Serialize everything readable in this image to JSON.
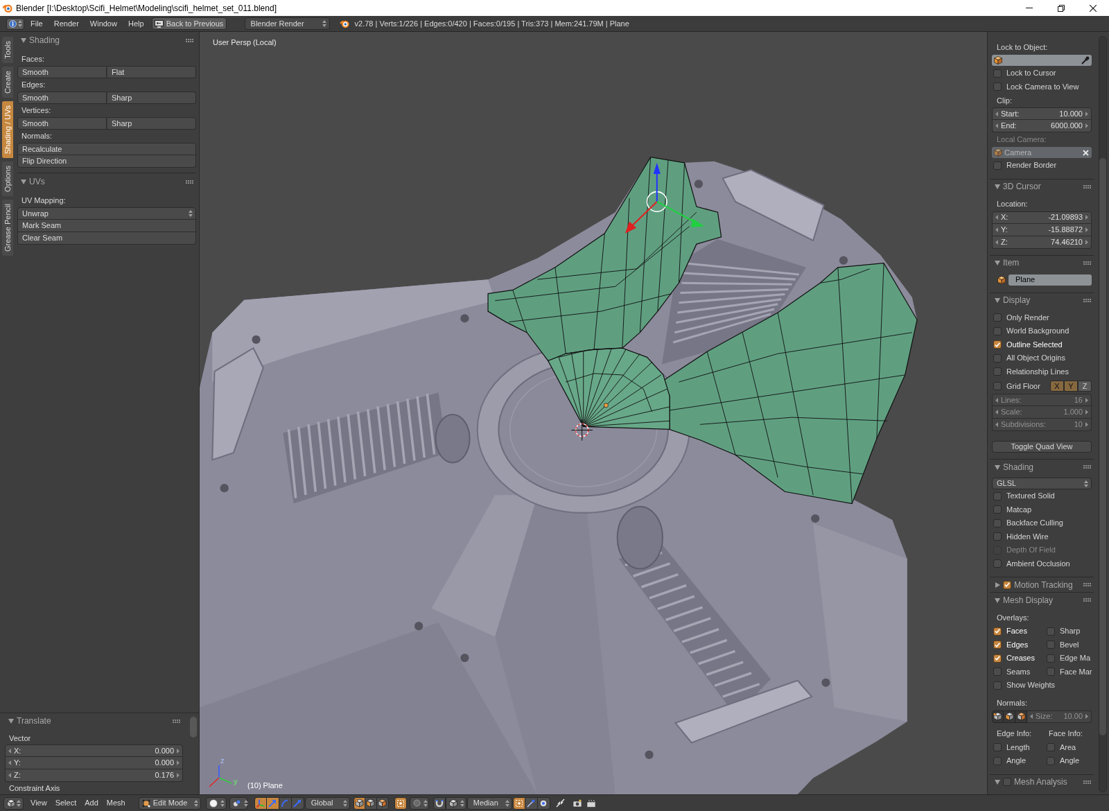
{
  "window": {
    "title": "Blender [I:\\Desktop\\Scifi_Helmet\\Modeling\\scifi_helmet_set_011.blend]"
  },
  "menu_bar": {
    "menus": [
      "File",
      "Render",
      "Window",
      "Help"
    ],
    "back_button": "Back to Previous",
    "render_engine": "Blender Render",
    "stats": "v2.78 | Verts:1/226 | Edges:0/420 | Faces:0/195 | Tris:373 | Mem:241.79M | Plane"
  },
  "tool_shelf": {
    "tabs": [
      {
        "label": "Tools",
        "selected": false
      },
      {
        "label": "Create",
        "selected": false
      },
      {
        "label": "Shading / UVs",
        "selected": true
      },
      {
        "label": "Options",
        "selected": false
      },
      {
        "label": "Grease Pencil",
        "selected": false
      }
    ],
    "panels": [
      {
        "title": "Shading",
        "expanded": true,
        "rows": [
          {
            "kind": "label",
            "text": "Faces:"
          },
          {
            "kind": "button_pair",
            "buttons": [
              "Smooth",
              "Flat"
            ]
          },
          {
            "kind": "label",
            "text": "Edges:"
          },
          {
            "kind": "button_pair",
            "buttons": [
              "Smooth",
              "Sharp"
            ]
          },
          {
            "kind": "label",
            "text": "Vertices:"
          },
          {
            "kind": "button_pair",
            "buttons": [
              "Smooth",
              "Sharp"
            ]
          },
          {
            "kind": "label",
            "text": "Normals:"
          },
          {
            "kind": "button",
            "text": "Recalculate"
          },
          {
            "kind": "button",
            "text": "Flip Direction"
          }
        ]
      },
      {
        "title": "UVs",
        "expanded": true,
        "rows": [
          {
            "kind": "label",
            "text": "UV Mapping:"
          },
          {
            "kind": "dropdown",
            "value": "Unwrap"
          },
          {
            "kind": "button",
            "text": "Mark Seam"
          },
          {
            "kind": "button",
            "text": "Clear Seam"
          }
        ]
      }
    ]
  },
  "operator_panel": {
    "title": "Translate",
    "expanded": true,
    "rows": [
      {
        "kind": "label",
        "text": "Vector"
      },
      {
        "kind": "number",
        "label": "X:",
        "value": "0.000"
      },
      {
        "kind": "number",
        "label": "Y:",
        "value": "0.000"
      },
      {
        "kind": "number",
        "label": "Z:",
        "value": "0.176"
      },
      {
        "kind": "label",
        "text": "Constraint Axis"
      }
    ]
  },
  "viewport": {
    "view_label": "User Persp (Local)",
    "object_label": "(10) Plane",
    "axis_labels": [
      "z",
      "y"
    ]
  },
  "properties": {
    "sections": [
      {
        "rows": [
          {
            "kind": "label",
            "text": "Lock to Object:",
            "disabled": false
          },
          {
            "kind": "object_field",
            "disabled": false
          },
          {
            "kind": "checkbox",
            "label": "Lock to Cursor",
            "checked": false,
            "disabled": false
          },
          {
            "kind": "checkbox",
            "label": "Lock Camera to View",
            "checked": false,
            "disabled": false
          },
          {
            "kind": "label",
            "text": "Clip:",
            "disabled": false
          },
          {
            "kind": "number",
            "label": "Start:",
            "value": "10.000",
            "disabled": false
          },
          {
            "kind": "number",
            "label": "End:",
            "value": "6000.000",
            "disabled": false
          },
          {
            "kind": "label",
            "text": "Local Camera:",
            "disabled": true
          },
          {
            "kind": "object_field",
            "value": "Camera",
            "disabled": true
          },
          {
            "kind": "checkbox",
            "label": "Render Border",
            "checked": false,
            "disabled": false
          }
        ]
      },
      {
        "title": "3D Cursor",
        "expanded": true,
        "rows": [
          {
            "kind": "label",
            "text": "Location:",
            "disabled": false
          },
          {
            "kind": "number",
            "label": "X:",
            "value": "-21.09893",
            "disabled": false
          },
          {
            "kind": "number",
            "label": "Y:",
            "value": "-15.88872",
            "disabled": false
          },
          {
            "kind": "number",
            "label": "Z:",
            "value": "74.46210",
            "disabled": false
          }
        ]
      },
      {
        "title": "Item",
        "expanded": true,
        "rows": [
          {
            "kind": "name_field",
            "value": "Plane",
            "disabled": false
          }
        ]
      },
      {
        "title": "Display",
        "expanded": true,
        "rows": [
          {
            "kind": "checkbox",
            "label": "Only Render",
            "checked": false,
            "disabled": false
          },
          {
            "kind": "checkbox",
            "label": "World Background",
            "checked": false,
            "disabled": false
          },
          {
            "kind": "checkbox",
            "label": "Outline Selected",
            "checked": true,
            "disabled": false
          },
          {
            "kind": "checkbox",
            "label": "All Object Origins",
            "checked": false,
            "disabled": false
          },
          {
            "kind": "checkbox",
            "label": "Relationship Lines",
            "checked": false,
            "disabled": false
          },
          {
            "kind": "grid_floor",
            "label": "Grid Floor",
            "checked": false,
            "disabled": false,
            "axes": [
              {
                "label": "X",
                "selected": true
              },
              {
                "label": "Y",
                "selected": true
              },
              {
                "label": "Z",
                "selected": false
              }
            ]
          },
          {
            "kind": "number",
            "label": "Lines:",
            "value": "16",
            "disabled": true
          },
          {
            "kind": "number",
            "label": "Scale:",
            "value": "1.000",
            "disabled": true
          },
          {
            "kind": "number",
            "label": "Subdivisions:",
            "value": "10",
            "disabled": true
          },
          {
            "kind": "button",
            "text": "Toggle Quad View",
            "disabled": false
          }
        ]
      },
      {
        "title": "Shading",
        "expanded": true,
        "rows": [
          {
            "kind": "dropdown",
            "value": "GLSL",
            "disabled": false
          },
          {
            "kind": "checkbox",
            "label": "Textured Solid",
            "checked": false,
            "disabled": false
          },
          {
            "kind": "checkbox",
            "label": "Matcap",
            "checked": false,
            "disabled": false
          },
          {
            "kind": "checkbox",
            "label": "Backface Culling",
            "checked": false,
            "disabled": false
          },
          {
            "kind": "checkbox",
            "label": "Hidden Wire",
            "checked": false,
            "disabled": false
          },
          {
            "kind": "checkbox",
            "label": "Depth Of Field",
            "checked": false,
            "disabled": true
          },
          {
            "kind": "checkbox",
            "label": "Ambient Occlusion",
            "checked": false,
            "disabled": false
          }
        ]
      },
      {
        "title": "Motion Tracking",
        "expanded": false,
        "toggle": {
          "checked": true
        }
      },
      {
        "title": "Mesh Display",
        "expanded": true,
        "rows": [
          {
            "kind": "label",
            "text": "Overlays:",
            "disabled": false
          },
          {
            "kind": "checkbox_pair",
            "disabled": false,
            "items": [
              {
                "label": "Faces",
                "checked": true
              },
              {
                "label": "Sharp",
                "checked": false
              }
            ]
          },
          {
            "kind": "checkbox_pair",
            "disabled": false,
            "items": [
              {
                "label": "Edges",
                "checked": true
              },
              {
                "label": "Bevel",
                "checked": false
              }
            ]
          },
          {
            "kind": "checkbox_pair",
            "disabled": false,
            "items": [
              {
                "label": "Creases",
                "checked": true
              },
              {
                "label": "Edge Ma",
                "checked": false
              }
            ]
          },
          {
            "kind": "checkbox_pair",
            "disabled": false,
            "items": [
              {
                "label": "Seams",
                "checked": false
              },
              {
                "label": "Face Mar",
                "checked": false
              }
            ]
          },
          {
            "kind": "checkbox",
            "label": "Show Weights",
            "checked": false,
            "disabled": false
          },
          {
            "kind": "label",
            "text": "Normals:",
            "disabled": false
          },
          {
            "kind": "normals",
            "label": "Size:",
            "value": "10.00",
            "disabled": true
          },
          {
            "kind": "label_pair",
            "texts": [
              "Edge Info:",
              "Face Info:"
            ],
            "disabled": false
          },
          {
            "kind": "checkbox_pair",
            "disabled": false,
            "items": [
              {
                "label": "Length",
                "checked": false
              },
              {
                "label": "Area",
                "checked": false
              }
            ]
          },
          {
            "kind": "checkbox_pair",
            "disabled": false,
            "items": [
              {
                "label": "Angle",
                "checked": false
              },
              {
                "label": "Angle",
                "checked": false
              }
            ]
          }
        ]
      },
      {
        "title": "Mesh Analysis",
        "expanded": true,
        "toggle": {
          "checked": false
        }
      }
    ]
  },
  "header": {
    "menus": [
      "View",
      "Select",
      "Add",
      "Mesh"
    ],
    "mode": "Edit Mode",
    "manipulators": [
      {
        "selected": true
      },
      {
        "selected": true
      },
      {
        "selected": false
      },
      {
        "selected": false
      }
    ],
    "orientation": "Global",
    "select_modes": [
      {
        "selected": true
      },
      {
        "selected": false
      },
      {
        "selected": false
      }
    ],
    "occlude_geometry": {
      "on": true
    },
    "snap": {
      "on": false
    },
    "snap_target": "Median",
    "snap_options": [
      {
        "on": true
      },
      {
        "on": false
      },
      {
        "on": false
      }
    ]
  }
}
